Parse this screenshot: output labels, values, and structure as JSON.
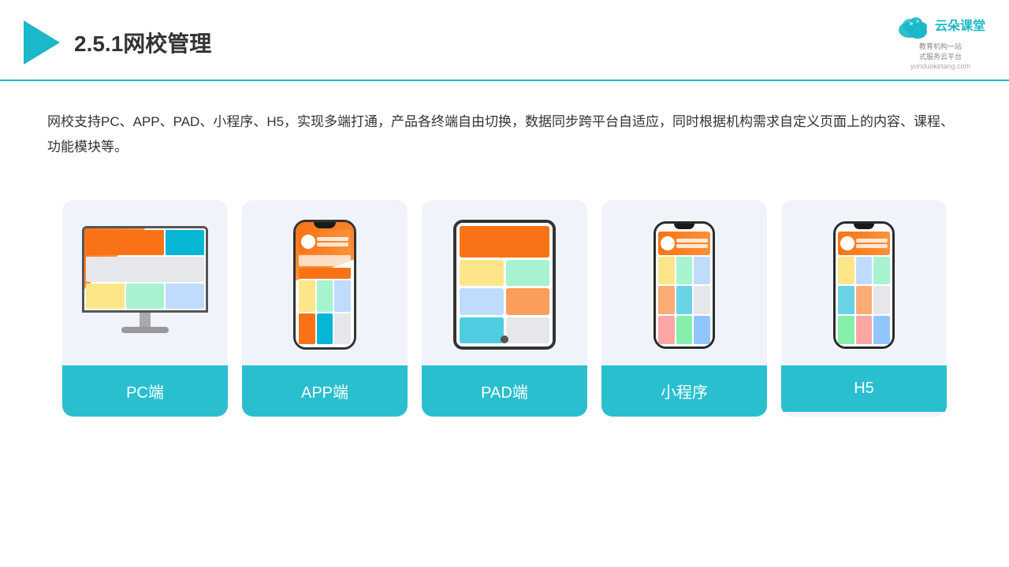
{
  "header": {
    "title": "2.5.1网校管理",
    "brand_cn": "云朵课堂",
    "brand_tagline": "教育机构一站\n式服务云平台",
    "brand_url": "yunduoketang.com"
  },
  "description": {
    "text": "网校支持PC、APP、PAD、小程序、H5，实现多端打通，产品各终端自由切换，数据同步跨平台自适应，同时根据机构需求自定义页面上的内容、课程、功能模块等。"
  },
  "cards": [
    {
      "label": "PC端",
      "type": "pc"
    },
    {
      "label": "APP端",
      "type": "app"
    },
    {
      "label": "PAD端",
      "type": "pad"
    },
    {
      "label": "小程序",
      "type": "mini"
    },
    {
      "label": "H5",
      "type": "h5"
    }
  ]
}
